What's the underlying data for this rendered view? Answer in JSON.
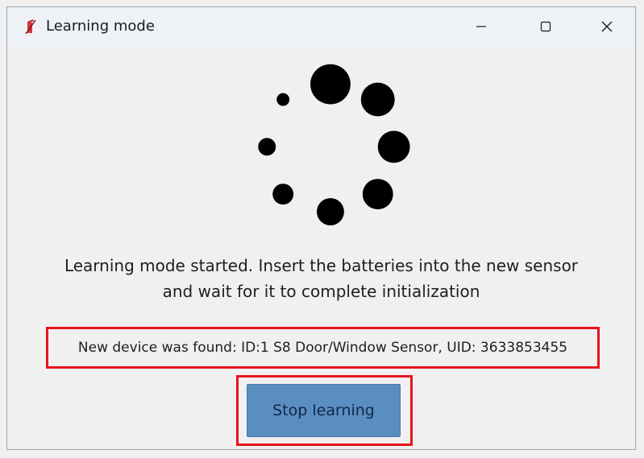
{
  "window": {
    "title": "Learning mode",
    "app_icon": "app-icon",
    "controls": {
      "minimize_icon": "minimize-icon",
      "maximize_icon": "maximize-icon",
      "close_icon": "close-icon"
    }
  },
  "spinner": {
    "icon": "loading-spinner-icon",
    "color": "#000000"
  },
  "message": {
    "line1": "Learning mode started. Insert the batteries into the new sensor",
    "line2": "and wait for it to complete initialization"
  },
  "status": {
    "found_text": "New device was found: ID:1 S8 Door/Window Sensor, UID: 3633853455"
  },
  "actions": {
    "stop_label": "Stop learning"
  },
  "colors": {
    "highlight": "#e8141c",
    "button_bg": "#5a8ec0",
    "button_text": "#12274a"
  }
}
